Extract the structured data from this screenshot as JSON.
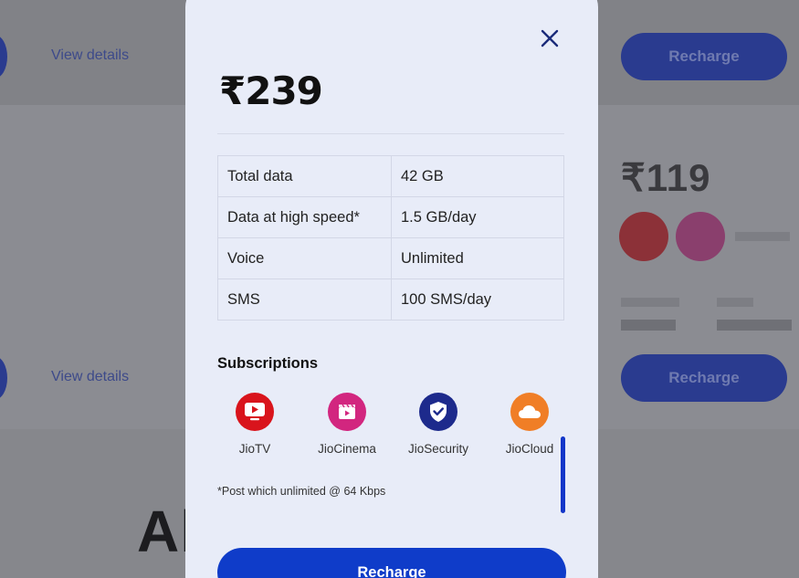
{
  "background": {
    "link_label": "View details",
    "recharge_label": "Recharge",
    "price": "₹119",
    "heading": "All plans"
  },
  "modal": {
    "price": "₹239",
    "specs": [
      {
        "key": "Total data",
        "value": "42 GB"
      },
      {
        "key": "Data at high speed*",
        "value": "1.5 GB/day"
      },
      {
        "key": "Voice",
        "value": "Unlimited"
      },
      {
        "key": "SMS",
        "value": "100 SMS/day"
      }
    ],
    "subscriptions_title": "Subscriptions",
    "subscriptions": [
      {
        "name": "JioTV",
        "icon": "jiotv-icon",
        "color": "#d9141c"
      },
      {
        "name": "JioCinema",
        "icon": "jiocinema-icon",
        "color": "#d2267f"
      },
      {
        "name": "JioSecurity",
        "icon": "jiosecurity-icon",
        "color": "#1d2a8c"
      },
      {
        "name": "JioCloud",
        "icon": "jiocloud-icon",
        "color": "#f07e26"
      }
    ],
    "footnote": "*Post which unlimited @ 64 Kbps",
    "recharge_label": "Recharge"
  },
  "colors": {
    "accent": "#0f3cc9",
    "modal_bg": "#e8ecf8"
  }
}
